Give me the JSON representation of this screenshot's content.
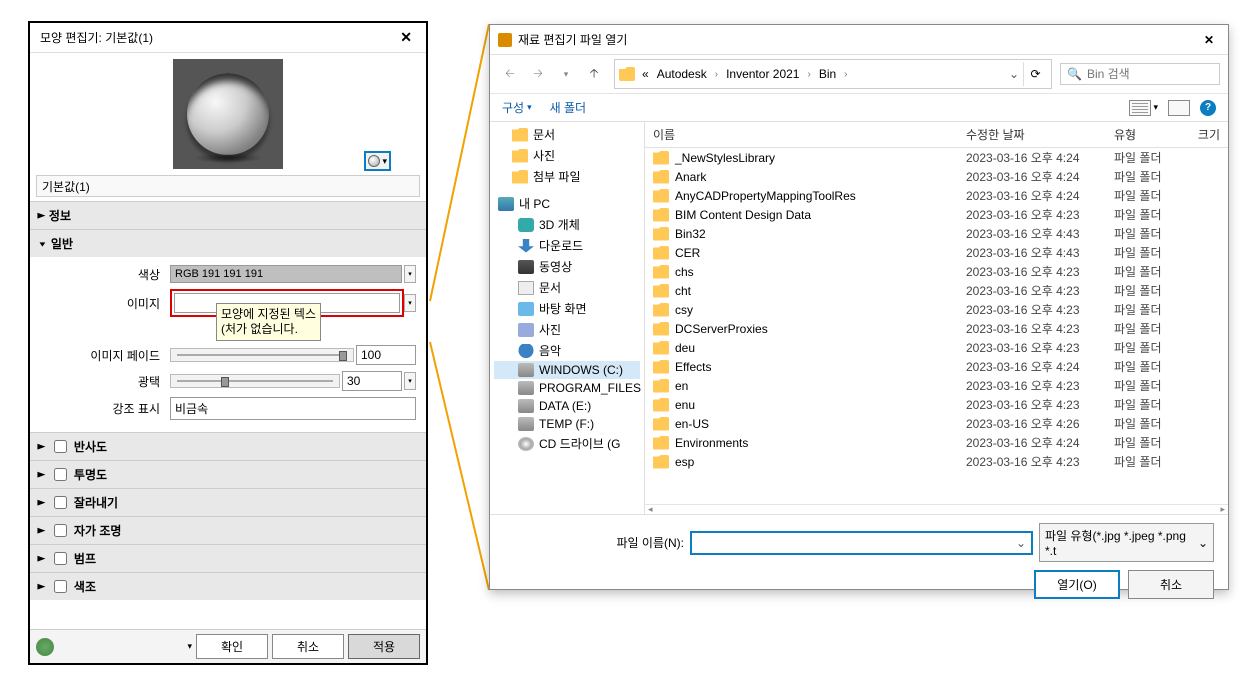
{
  "left_window": {
    "title": "모양 편집기: 기본값(1)",
    "name_field": "기본값(1)",
    "sections": {
      "info": "정보",
      "general": "일반",
      "props": {
        "color_label": "색상",
        "color_value": "RGB 191 191 191",
        "image_label": "이미지",
        "image_tooltip_l1": "모양에 지정된 텍스",
        "image_tooltip_l2": "(처가 없습니다.",
        "fade_label": "이미지 페이드",
        "fade_value": "100",
        "gloss_label": "광택",
        "gloss_value": "30",
        "highlight_label": "강조 표시",
        "highlight_value": "비금속"
      },
      "reflect": "반사도",
      "transparency": "투명도",
      "cutout": "잘라내기",
      "selfillum": "자가 조명",
      "bump": "범프",
      "tint": "색조"
    },
    "buttons": {
      "ok": "확인",
      "cancel": "취소",
      "apply": "적용"
    }
  },
  "right_window": {
    "title": "재료 편집기 파일 열기",
    "breadcrumb": {
      "p0": "«",
      "p1": "Autodesk",
      "p2": "Inventor 2021",
      "p3": "Bin"
    },
    "search_placeholder": "Bin 검색",
    "toolbar": {
      "org": "구성",
      "newfolder": "새 폴더"
    },
    "tree": [
      {
        "label": "문서",
        "ico": "ico-folder"
      },
      {
        "label": "사진",
        "ico": "ico-folder"
      },
      {
        "label": "첨부 파일",
        "ico": "ico-folder"
      },
      {
        "label": "내 PC",
        "ico": "ico-pc"
      },
      {
        "label": "3D 개체",
        "ico": "ico-3d"
      },
      {
        "label": "다운로드",
        "ico": "ico-dl"
      },
      {
        "label": "동영상",
        "ico": "ico-video"
      },
      {
        "label": "문서",
        "ico": "ico-doc"
      },
      {
        "label": "바탕 화면",
        "ico": "ico-desktop"
      },
      {
        "label": "사진",
        "ico": "ico-pic"
      },
      {
        "label": "음악",
        "ico": "ico-music"
      },
      {
        "label": "WINDOWS (C:)",
        "ico": "ico-drive",
        "sel": true
      },
      {
        "label": "PROGRAM_FILES",
        "ico": "ico-drive"
      },
      {
        "label": "DATA (E:)",
        "ico": "ico-drive"
      },
      {
        "label": "TEMP (F:)",
        "ico": "ico-drive"
      },
      {
        "label": "CD 드라이브 (G",
        "ico": "ico-cd"
      }
    ],
    "cols": {
      "name": "이름",
      "date": "수정한 날짜",
      "type": "유형",
      "size": "크기"
    },
    "files": [
      {
        "name": "_NewStylesLibrary",
        "date": "2023-03-16 오후 4:24",
        "type": "파일 폴더"
      },
      {
        "name": "Anark",
        "date": "2023-03-16 오후 4:24",
        "type": "파일 폴더"
      },
      {
        "name": "AnyCADPropertyMappingToolRes",
        "date": "2023-03-16 오후 4:24",
        "type": "파일 폴더"
      },
      {
        "name": "BIM Content Design Data",
        "date": "2023-03-16 오후 4:23",
        "type": "파일 폴더"
      },
      {
        "name": "Bin32",
        "date": "2023-03-16 오후 4:43",
        "type": "파일 폴더"
      },
      {
        "name": "CER",
        "date": "2023-03-16 오후 4:43",
        "type": "파일 폴더"
      },
      {
        "name": "chs",
        "date": "2023-03-16 오후 4:23",
        "type": "파일 폴더"
      },
      {
        "name": "cht",
        "date": "2023-03-16 오후 4:23",
        "type": "파일 폴더"
      },
      {
        "name": "csy",
        "date": "2023-03-16 오후 4:23",
        "type": "파일 폴더"
      },
      {
        "name": "DCServerProxies",
        "date": "2023-03-16 오후 4:23",
        "type": "파일 폴더"
      },
      {
        "name": "deu",
        "date": "2023-03-16 오후 4:23",
        "type": "파일 폴더"
      },
      {
        "name": "Effects",
        "date": "2023-03-16 오후 4:24",
        "type": "파일 폴더"
      },
      {
        "name": "en",
        "date": "2023-03-16 오후 4:23",
        "type": "파일 폴더"
      },
      {
        "name": "enu",
        "date": "2023-03-16 오후 4:23",
        "type": "파일 폴더"
      },
      {
        "name": "en-US",
        "date": "2023-03-16 오후 4:26",
        "type": "파일 폴더"
      },
      {
        "name": "Environments",
        "date": "2023-03-16 오후 4:24",
        "type": "파일 폴더"
      },
      {
        "name": "esp",
        "date": "2023-03-16 오후 4:23",
        "type": "파일 폴더"
      }
    ],
    "filename_label": "파일 이름(N):",
    "filter": "파일 유형(*.jpg *.jpeg *.png *.t",
    "open": "열기(O)",
    "cancel": "취소"
  }
}
